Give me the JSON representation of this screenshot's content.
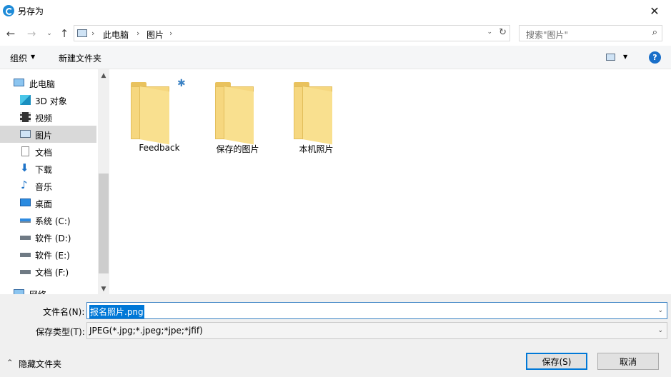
{
  "window": {
    "title": "另存为",
    "close_glyph": "✕"
  },
  "nav": {
    "back_glyph": "←",
    "forward_glyph": "→",
    "recent_glyph": "⌄",
    "up_glyph": "↑",
    "address_segments": [
      "此电脑",
      "图片"
    ],
    "address_sep": "›",
    "dropdown_glyph": "⌄",
    "refresh_glyph": "↻",
    "search_placeholder": "搜索\"图片\"",
    "search_glyph": "⌕"
  },
  "commands": {
    "organize": "组织",
    "new_folder": "新建文件夹",
    "caret": "▼",
    "help": "?"
  },
  "sidebar": {
    "items": [
      {
        "label": "此电脑",
        "icon": "pc-icon"
      },
      {
        "label": "3D 对象",
        "icon": "cube-icon"
      },
      {
        "label": "视频",
        "icon": "film-icon"
      },
      {
        "label": "图片",
        "icon": "picture-icon",
        "selected": true
      },
      {
        "label": "文档",
        "icon": "document-icon"
      },
      {
        "label": "下载",
        "icon": "download-icon"
      },
      {
        "label": "音乐",
        "icon": "music-icon"
      },
      {
        "label": "桌面",
        "icon": "desktop-icon"
      },
      {
        "label": "系统 (C:)",
        "icon": "system-drive-icon"
      },
      {
        "label": "软件 (D:)",
        "icon": "drive-icon"
      },
      {
        "label": "软件 (E:)",
        "icon": "drive-icon"
      },
      {
        "label": "文档 (F:)",
        "icon": "drive-icon"
      },
      {
        "label": "网络",
        "icon": "network-icon"
      }
    ],
    "scroll_up": "▲",
    "scroll_down": "▼"
  },
  "folders": [
    {
      "label": "Feedback",
      "icon": "folder-icon"
    },
    {
      "label": "保存的图片",
      "icon": "folder-icon"
    },
    {
      "label": "本机照片",
      "icon": "folder-icon"
    }
  ],
  "form": {
    "filename_label": "文件名(N):",
    "filename_value": "报名照片.png",
    "filetype_label": "保存类型(T):",
    "filetype_value": "JPEG(*.jpg;*.jpeg;*jpe;*jfif)",
    "dropdown_glyph": "⌄"
  },
  "footer": {
    "hide_folders": "隐藏文件夹",
    "hide_caret": "^",
    "save": "保存(S)",
    "cancel": "取消"
  }
}
